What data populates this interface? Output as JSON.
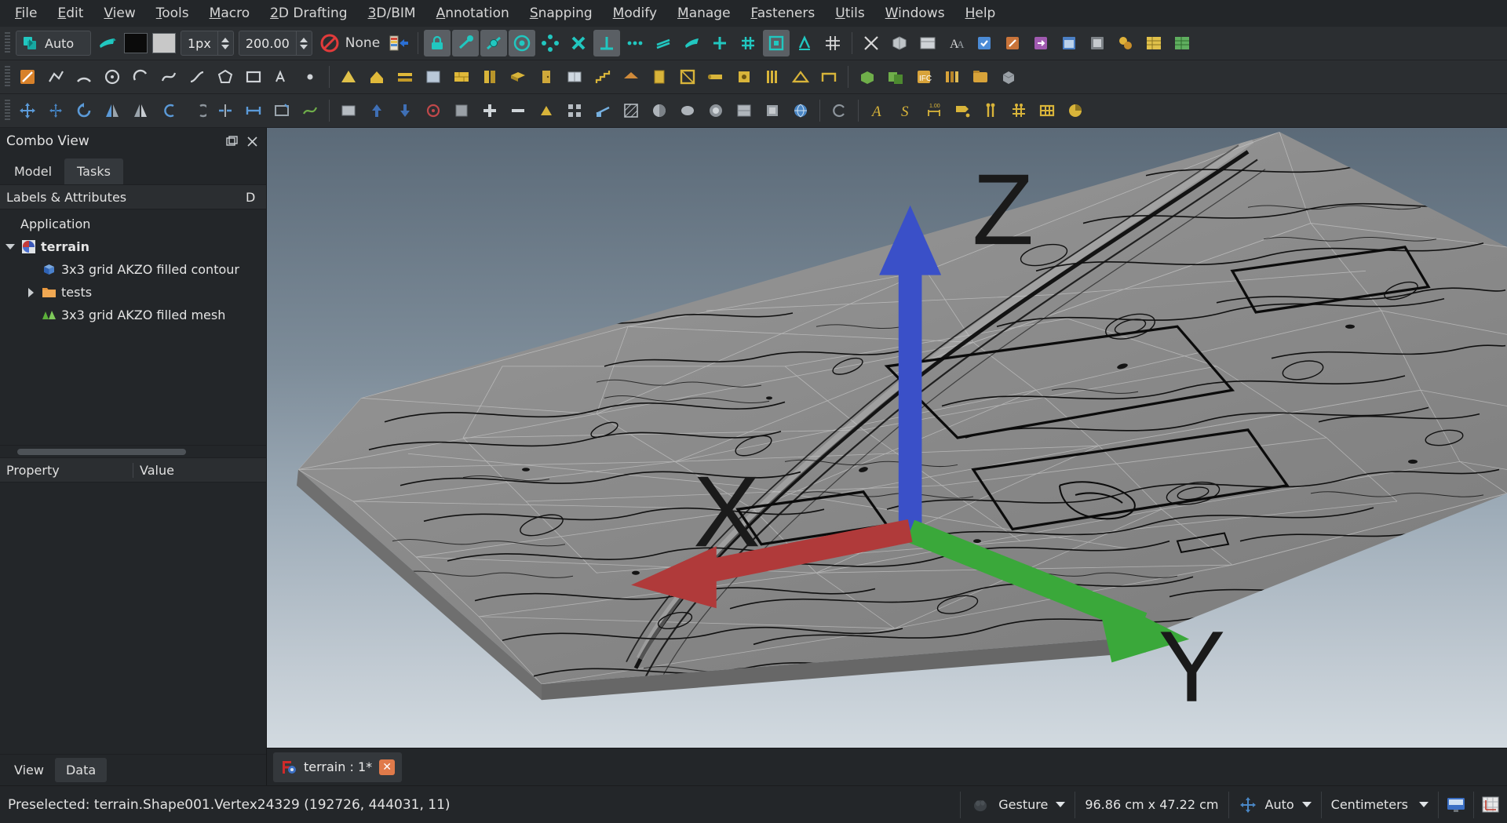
{
  "menubar": {
    "items": [
      {
        "label": "File",
        "mnemonic": "F"
      },
      {
        "label": "Edit",
        "mnemonic": "E"
      },
      {
        "label": "View",
        "mnemonic": "V"
      },
      {
        "label": "Tools",
        "mnemonic": "T"
      },
      {
        "label": "Macro",
        "mnemonic": "M"
      },
      {
        "label": "2D Drafting",
        "mnemonic": "2"
      },
      {
        "label": "3D/BIM",
        "mnemonic": "3"
      },
      {
        "label": "Annotation",
        "mnemonic": "A"
      },
      {
        "label": "Snapping",
        "mnemonic": "S"
      },
      {
        "label": "Modify",
        "mnemonic": "M"
      },
      {
        "label": "Manage",
        "mnemonic": "M"
      },
      {
        "label": "Fasteners",
        "mnemonic": "F"
      },
      {
        "label": "Utils",
        "mnemonic": "U"
      },
      {
        "label": "Windows",
        "mnemonic": "W"
      },
      {
        "label": "Help",
        "mnemonic": "H"
      }
    ]
  },
  "toolbar_draft": {
    "autogroup_label": "Auto",
    "line_width_value": "1px",
    "text_size_value": "200.00",
    "working_plane_label": "None",
    "line_color": "#0b0b0b",
    "face_color": "#c8c8c8",
    "accent": "#21c7c0"
  },
  "toolbar_snap": {
    "buttons": [
      {
        "name": "snap-lock",
        "active": true
      },
      {
        "name": "snap-endpoint",
        "active": true
      },
      {
        "name": "snap-midpoint",
        "active": true
      },
      {
        "name": "snap-center",
        "active": true
      },
      {
        "name": "snap-angle",
        "active": false
      },
      {
        "name": "snap-intersection",
        "active": false
      },
      {
        "name": "snap-perpendicular",
        "active": true
      },
      {
        "name": "snap-extension",
        "active": false
      },
      {
        "name": "snap-parallel",
        "active": false
      },
      {
        "name": "snap-special",
        "active": false
      },
      {
        "name": "snap-near",
        "active": false
      },
      {
        "name": "snap-ortho",
        "active": false
      },
      {
        "name": "snap-grid",
        "active": false
      },
      {
        "name": "snap-working-plane",
        "active": true
      },
      {
        "name": "snap-dimensions",
        "active": false
      },
      {
        "name": "toggle-grid",
        "active": false
      }
    ]
  },
  "combo_view": {
    "title": "Combo View",
    "tabs": [
      {
        "label": "Model",
        "selected": false
      },
      {
        "label": "Tasks",
        "selected": true
      }
    ],
    "tree_header": {
      "labels_col": "Labels & Attributes",
      "data_col": "D"
    },
    "tree": [
      {
        "label": "Application",
        "level": 0,
        "expander": "none",
        "icon": "none",
        "bold": false
      },
      {
        "label": "terrain",
        "level": 1,
        "expander": "down",
        "icon": "document-icon",
        "bold": true
      },
      {
        "label": "3x3 grid AKZO filled contour",
        "level": 2,
        "expander": "none",
        "icon": "part-cube-icon",
        "bold": false
      },
      {
        "label": "tests",
        "level": 2,
        "expander": "right",
        "icon": "folder-icon",
        "bold": false
      },
      {
        "label": "3x3 grid AKZO filled mesh",
        "level": 2,
        "expander": "none",
        "icon": "mesh-icon",
        "bold": false
      }
    ],
    "property_header": {
      "property_col": "Property",
      "value_col": "Value"
    },
    "bottom_tabs": [
      {
        "label": "View",
        "selected": false
      },
      {
        "label": "Data",
        "selected": true
      }
    ]
  },
  "document_tabs": [
    {
      "label": "terrain : 1*",
      "modified": true,
      "close_label": "✕"
    }
  ],
  "viewport": {
    "axis_labels": {
      "x": "X",
      "y": "Y",
      "z": "Z"
    },
    "axis_colors": {
      "x": "#b03a3a",
      "y": "#3aa83a",
      "z": "#3a50c8"
    },
    "background_top": "#5b6a78",
    "background_bottom": "#d2dae0",
    "mesh_fill": "#8d8d8d",
    "mesh_wire": "#d6d6d6",
    "contour_color": "#111111"
  },
  "statusbar": {
    "message": "Preselected: terrain.Shape001.Vertex24329 (192726, 444031, 11)",
    "navigation_style": "Gesture",
    "dimensions": "96.86 cm x 47.22 cm",
    "autogroup": "Auto",
    "units": "Centimeters"
  }
}
